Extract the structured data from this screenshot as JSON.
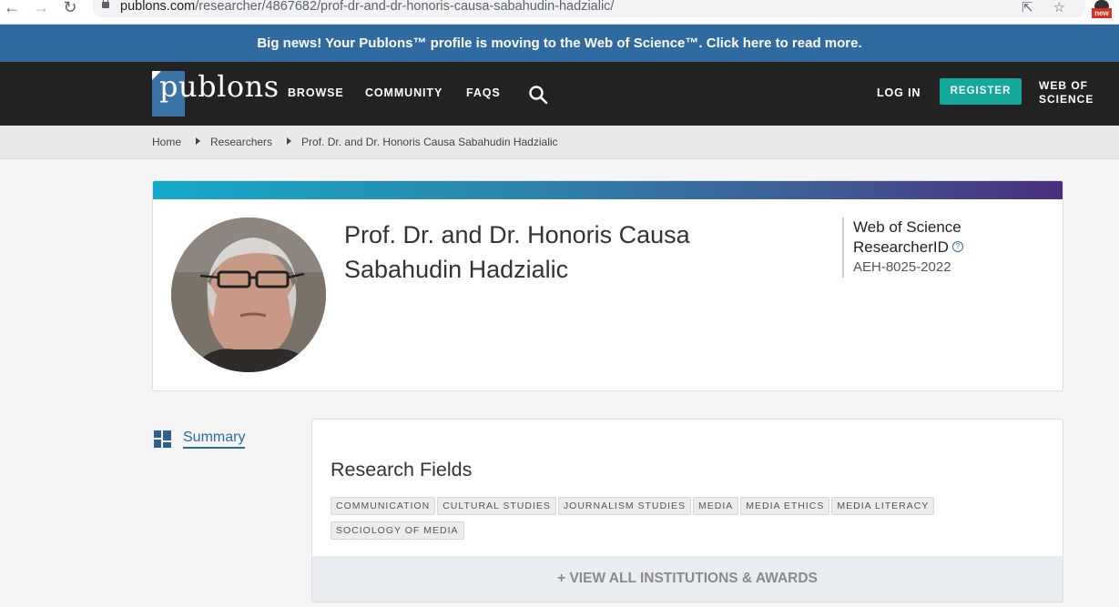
{
  "browser": {
    "url_host": "publons.com",
    "url_path": "/researcher/4867682/prof-dr-and-dr-honoris-causa-sabahudin-hadzialic/",
    "extension_badge": "new"
  },
  "banner": {
    "text": "Big news! Your Publons™ profile is moving to the Web of Science™. Click here to read more."
  },
  "header": {
    "logo": "publons",
    "nav": {
      "browse": "BROWSE",
      "community": "COMMUNITY",
      "faqs": "FAQS"
    },
    "login": "LOG IN",
    "register": "REGISTER",
    "wos_line1": "WEB OF",
    "wos_line2": "SCIENCE"
  },
  "breadcrumb": {
    "home": "Home",
    "researchers": "Researchers",
    "current": "Prof. Dr. and Dr. Honoris Causa Sabahudin Hadzialic"
  },
  "profile": {
    "name_line1": "Prof. Dr. and Dr. Honoris Causa",
    "name_line2": "Sabahudin Hadzialic",
    "rid_label_line1": "Web of Science",
    "rid_label_line2": "ResearcherID",
    "rid_value": "AEH-8025-2022",
    "help_glyph": "?"
  },
  "sidenav": {
    "summary": "Summary"
  },
  "research": {
    "title": "Research Fields",
    "fields": [
      "COMMUNICATION",
      "CULTURAL STUDIES",
      "JOURNALISM STUDIES",
      "MEDIA",
      "MEDIA ETHICS",
      "MEDIA LITERACY",
      "SOCIOLOGY OF MEDIA"
    ],
    "view_all": "+ VIEW ALL INSTITUTIONS & AWARDS"
  },
  "colors": {
    "banner": "#2f6aa1",
    "header": "#222222",
    "register": "#14a89c",
    "accent": "#2f6aa1"
  }
}
